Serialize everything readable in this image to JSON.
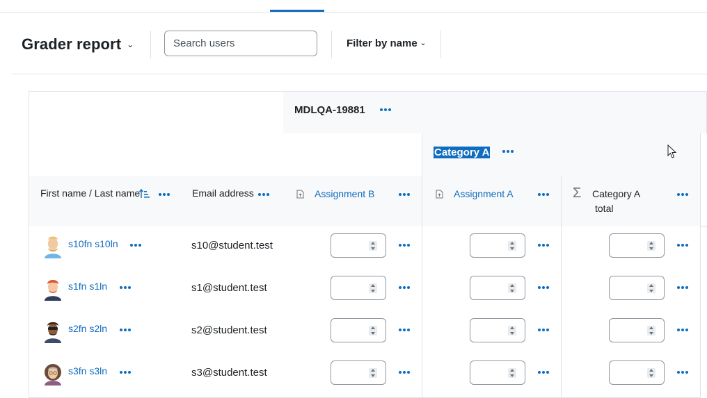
{
  "toolbar": {
    "report_title": "Grader report",
    "search_placeholder": "Search users",
    "filter_label": "Filter by name"
  },
  "grid": {
    "course_name": "MDLQA-19881",
    "category_name": "Category A",
    "headers": {
      "name": "First name / Last name",
      "email": "Email address",
      "assignment_b": "Assignment B",
      "assignment_a": "Assignment A",
      "category_total_line1": "Category A",
      "category_total_line2": "total"
    },
    "rows": [
      {
        "name": "s10fn s10ln",
        "email": "s10@student.test"
      },
      {
        "name": "s1fn s1ln",
        "email": "s1@student.test"
      },
      {
        "name": "s2fn s2ln",
        "email": "s2@student.test"
      },
      {
        "name": "s3fn s3ln",
        "email": "s3@student.test"
      }
    ]
  },
  "colors": {
    "accent": "#0f6cbf",
    "header_bg": "#f8f9fa",
    "border": "#dee2e6"
  },
  "icons": {
    "sort": "sort-ascending-icon",
    "actions": "kebab-menu-icon",
    "grade_item": "assignment-icon",
    "total": "sigma-icon"
  }
}
